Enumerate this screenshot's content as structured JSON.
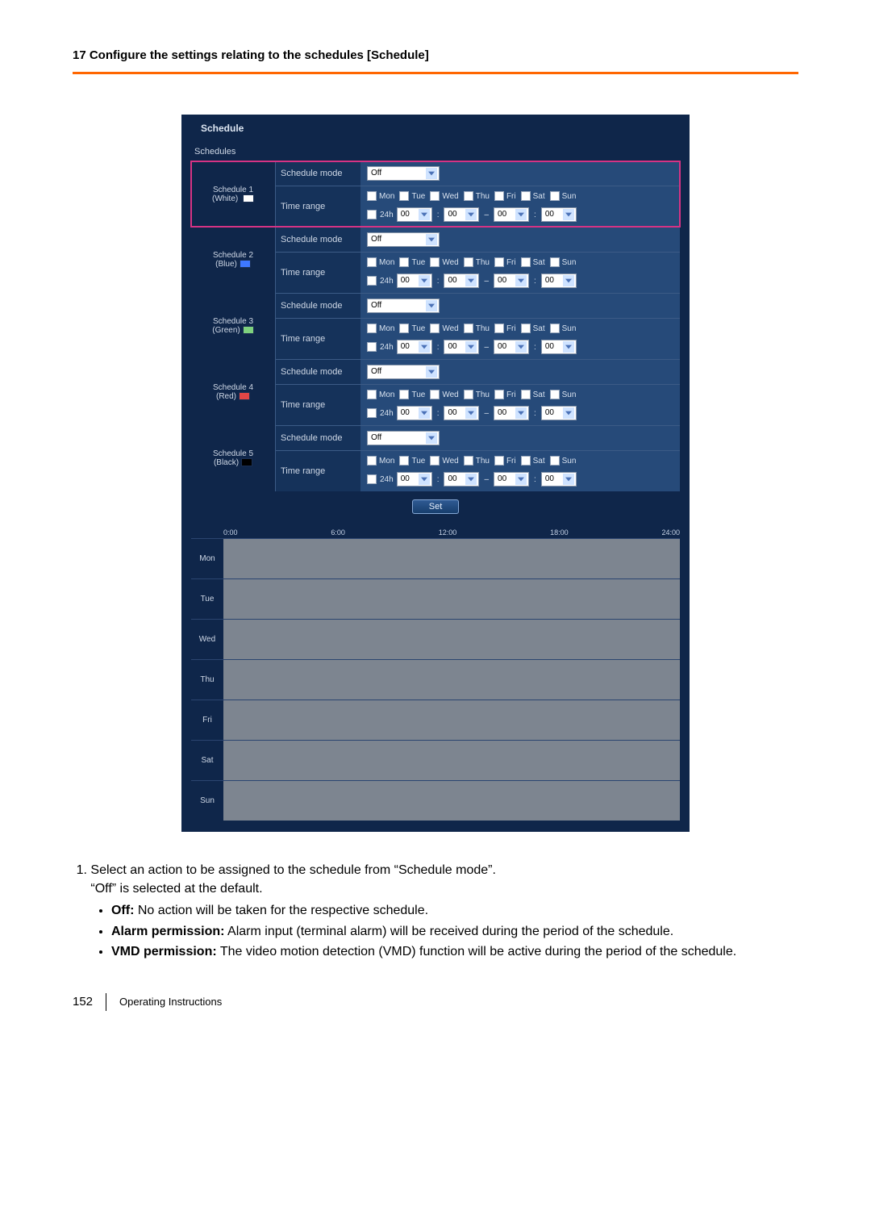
{
  "header": {
    "title": "17 Configure the settings relating to the schedules [Schedule]"
  },
  "panel": {
    "title": "Schedule",
    "section": "Schedules",
    "labels": {
      "schedule_mode": "Schedule mode",
      "time_range": "Time range",
      "h24": "24h",
      "dash": "–",
      "colon": ":"
    },
    "mode_value": "Off",
    "time_value": "00",
    "days": [
      "Mon",
      "Tue",
      "Wed",
      "Thu",
      "Fri",
      "Sat",
      "Sun"
    ],
    "schedules": [
      {
        "name": "Schedule 1",
        "color_name": "(White)",
        "swatch": "#ffffff"
      },
      {
        "name": "Schedule 2",
        "color_name": "(Blue)",
        "swatch": "#3e78ff"
      },
      {
        "name": "Schedule 3",
        "color_name": "(Green)",
        "swatch": "#7ed17e"
      },
      {
        "name": "Schedule 4",
        "color_name": "(Red)",
        "swatch": "#e24646"
      },
      {
        "name": "Schedule 5",
        "color_name": "(Black)",
        "swatch": "#000000"
      }
    ],
    "set_button": "Set",
    "timeline_labels": [
      "0:00",
      "6:00",
      "12:00",
      "18:00",
      "24:00"
    ],
    "timeline_days": [
      "Mon",
      "Tue",
      "Wed",
      "Thu",
      "Fri",
      "Sat",
      "Sun"
    ]
  },
  "instructions": {
    "step1_a": "Select an action to be assigned to the schedule from “Schedule mode”.",
    "step1_b": "“Off” is selected at the default.",
    "bullets": [
      {
        "label": "Off:",
        "text": " No action will be taken for the respective schedule."
      },
      {
        "label": "Alarm permission:",
        "text": " Alarm input (terminal alarm) will be received during the period of the schedule."
      },
      {
        "label": "VMD permission:",
        "text": " The video motion detection (VMD) function will be active during the period of the schedule."
      }
    ]
  },
  "footer": {
    "page": "152",
    "doc": "Operating Instructions"
  }
}
